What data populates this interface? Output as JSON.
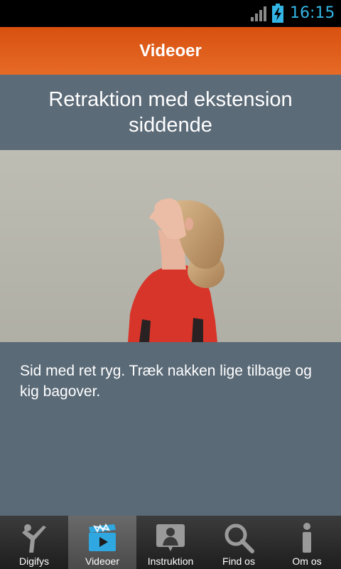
{
  "status_bar": {
    "time": "16:15",
    "icons": [
      "signal-icon",
      "battery-charging-icon"
    ],
    "accent_color": "#33b5e5"
  },
  "header": {
    "title": "Videoer",
    "color": "#e05a18"
  },
  "exercise": {
    "title": "Retraktion med ekstension siddende",
    "description": "Sid med ret ryg. Træk nakken lige tilbage og kig bagover."
  },
  "tabs": [
    {
      "label": "Digifys",
      "icon": "digifys-logo-icon",
      "active": false
    },
    {
      "label": "Videoer",
      "icon": "video-clapper-icon",
      "active": true
    },
    {
      "label": "Instruktion",
      "icon": "instruction-person-icon",
      "active": false
    },
    {
      "label": "Find os",
      "icon": "search-icon",
      "active": false
    },
    {
      "label": "Om os",
      "icon": "info-icon",
      "active": false
    }
  ]
}
